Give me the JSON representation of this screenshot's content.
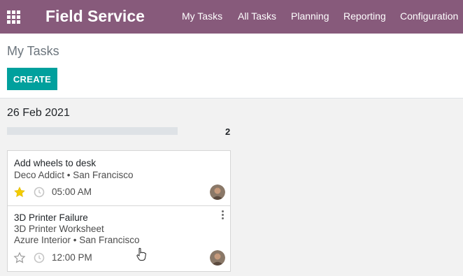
{
  "navbar": {
    "brand": "Field Service",
    "menu": [
      "My Tasks",
      "All Tasks",
      "Planning",
      "Reporting",
      "Configuration"
    ],
    "apps_icon": "grid-icon",
    "color": "#875a7b"
  },
  "control_panel": {
    "breadcrumb": "My Tasks",
    "create_label": "CREATE",
    "create_color": "#00a09d"
  },
  "column": {
    "title": "26 Feb 2021",
    "count": "2",
    "progress": 0
  },
  "cards": [
    {
      "title": "Add wheels to desk",
      "customer": "Deco Addict • San Francisco",
      "time": "05:00 AM",
      "starred": true
    },
    {
      "title": "3D Printer Failure",
      "worksheet": "3D Printer Worksheet",
      "customer": "Azure Interior • San Francisco",
      "time": "12:00 PM",
      "starred": false
    }
  ],
  "colors": {
    "star_active": "#f3cc00",
    "accent": "#00a09d"
  }
}
